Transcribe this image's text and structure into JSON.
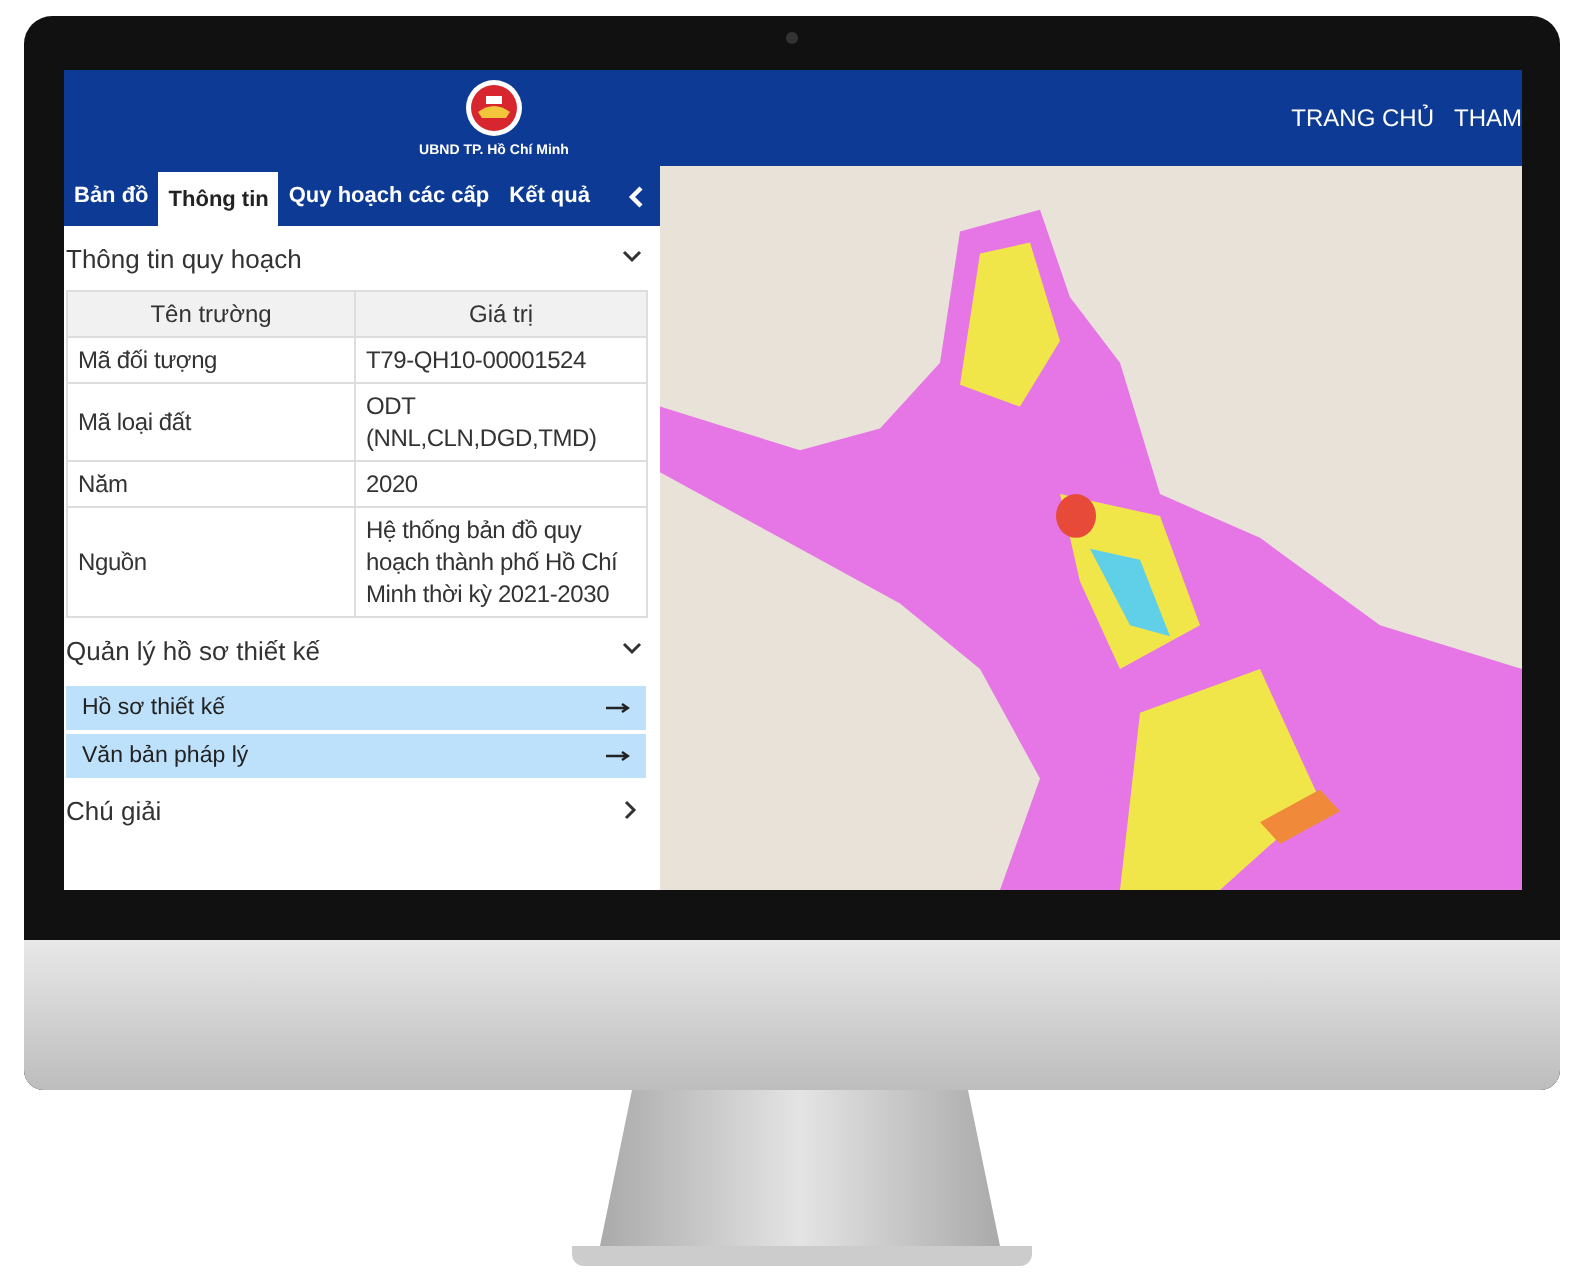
{
  "header": {
    "logo_caption": "UBND TP. Hồ Chí Minh",
    "nav": [
      "TRANG CHỦ",
      "THAM"
    ]
  },
  "tabs": [
    {
      "label": "Bản đồ",
      "selected": false
    },
    {
      "label": "Thông tin",
      "selected": true
    },
    {
      "label": "Quy hoạch các cấp",
      "selected": false
    },
    {
      "label": "Kết quả",
      "selected": false
    }
  ],
  "sections": [
    {
      "title": "Thông tin quy hoạch",
      "expanded": true,
      "kind": "table",
      "columns": [
        "Tên trường",
        "Giá trị"
      ],
      "rows": [
        [
          "Mã đối tượng",
          "T79-QH10-00001524"
        ],
        [
          "Mã loại đất",
          "ODT (NNL,CLN,DGD,TMD)"
        ],
        [
          "Năm",
          "2020"
        ],
        [
          "Nguồn",
          "Hệ thống bản đồ quy hoạch thành phố Hồ Chí Minh thời kỳ 2021-2030"
        ]
      ]
    },
    {
      "title": "Quản lý hồ sơ thiết kế",
      "expanded": true,
      "kind": "links",
      "links": [
        "Hồ sơ thiết kế",
        "Văn bản pháp lý"
      ]
    },
    {
      "title": "Chú giải",
      "expanded": false
    }
  ]
}
